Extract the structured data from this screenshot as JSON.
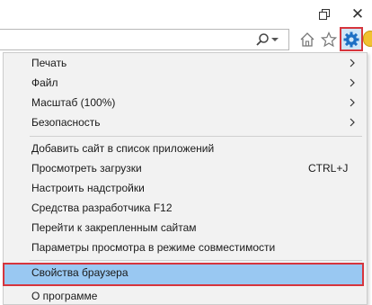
{
  "window": {
    "restore_icon": "restore-icon",
    "close_icon": "close-icon",
    "close_glyph": "✕"
  },
  "toolbar": {
    "search_icon": "search-icon",
    "home_icon": "home-icon",
    "star_icon": "star-icon",
    "gear_icon": "gear-icon",
    "accent_color": "#1c6fc4",
    "highlight_border_color": "#d6353d"
  },
  "menu": {
    "group1": [
      {
        "label": "Печать"
      },
      {
        "label": "Файл"
      },
      {
        "label": "Масштаб (100%)"
      },
      {
        "label": "Безопасность"
      }
    ],
    "group2": [
      {
        "label": "Добавить сайт в список приложений"
      },
      {
        "label": "Просмотреть загрузки",
        "shortcut": "CTRL+J"
      },
      {
        "label": "Настроить надстройки"
      },
      {
        "label": "Средства разработчика F12"
      },
      {
        "label": "Перейти к закрепленным сайтам"
      },
      {
        "label": "Параметры просмотра в режиме совместимости"
      }
    ],
    "group3": [
      {
        "label": "Свойства браузера",
        "highlighted": true
      },
      {
        "label": "О программе"
      }
    ],
    "highlight_bg": "#99c8f2"
  }
}
